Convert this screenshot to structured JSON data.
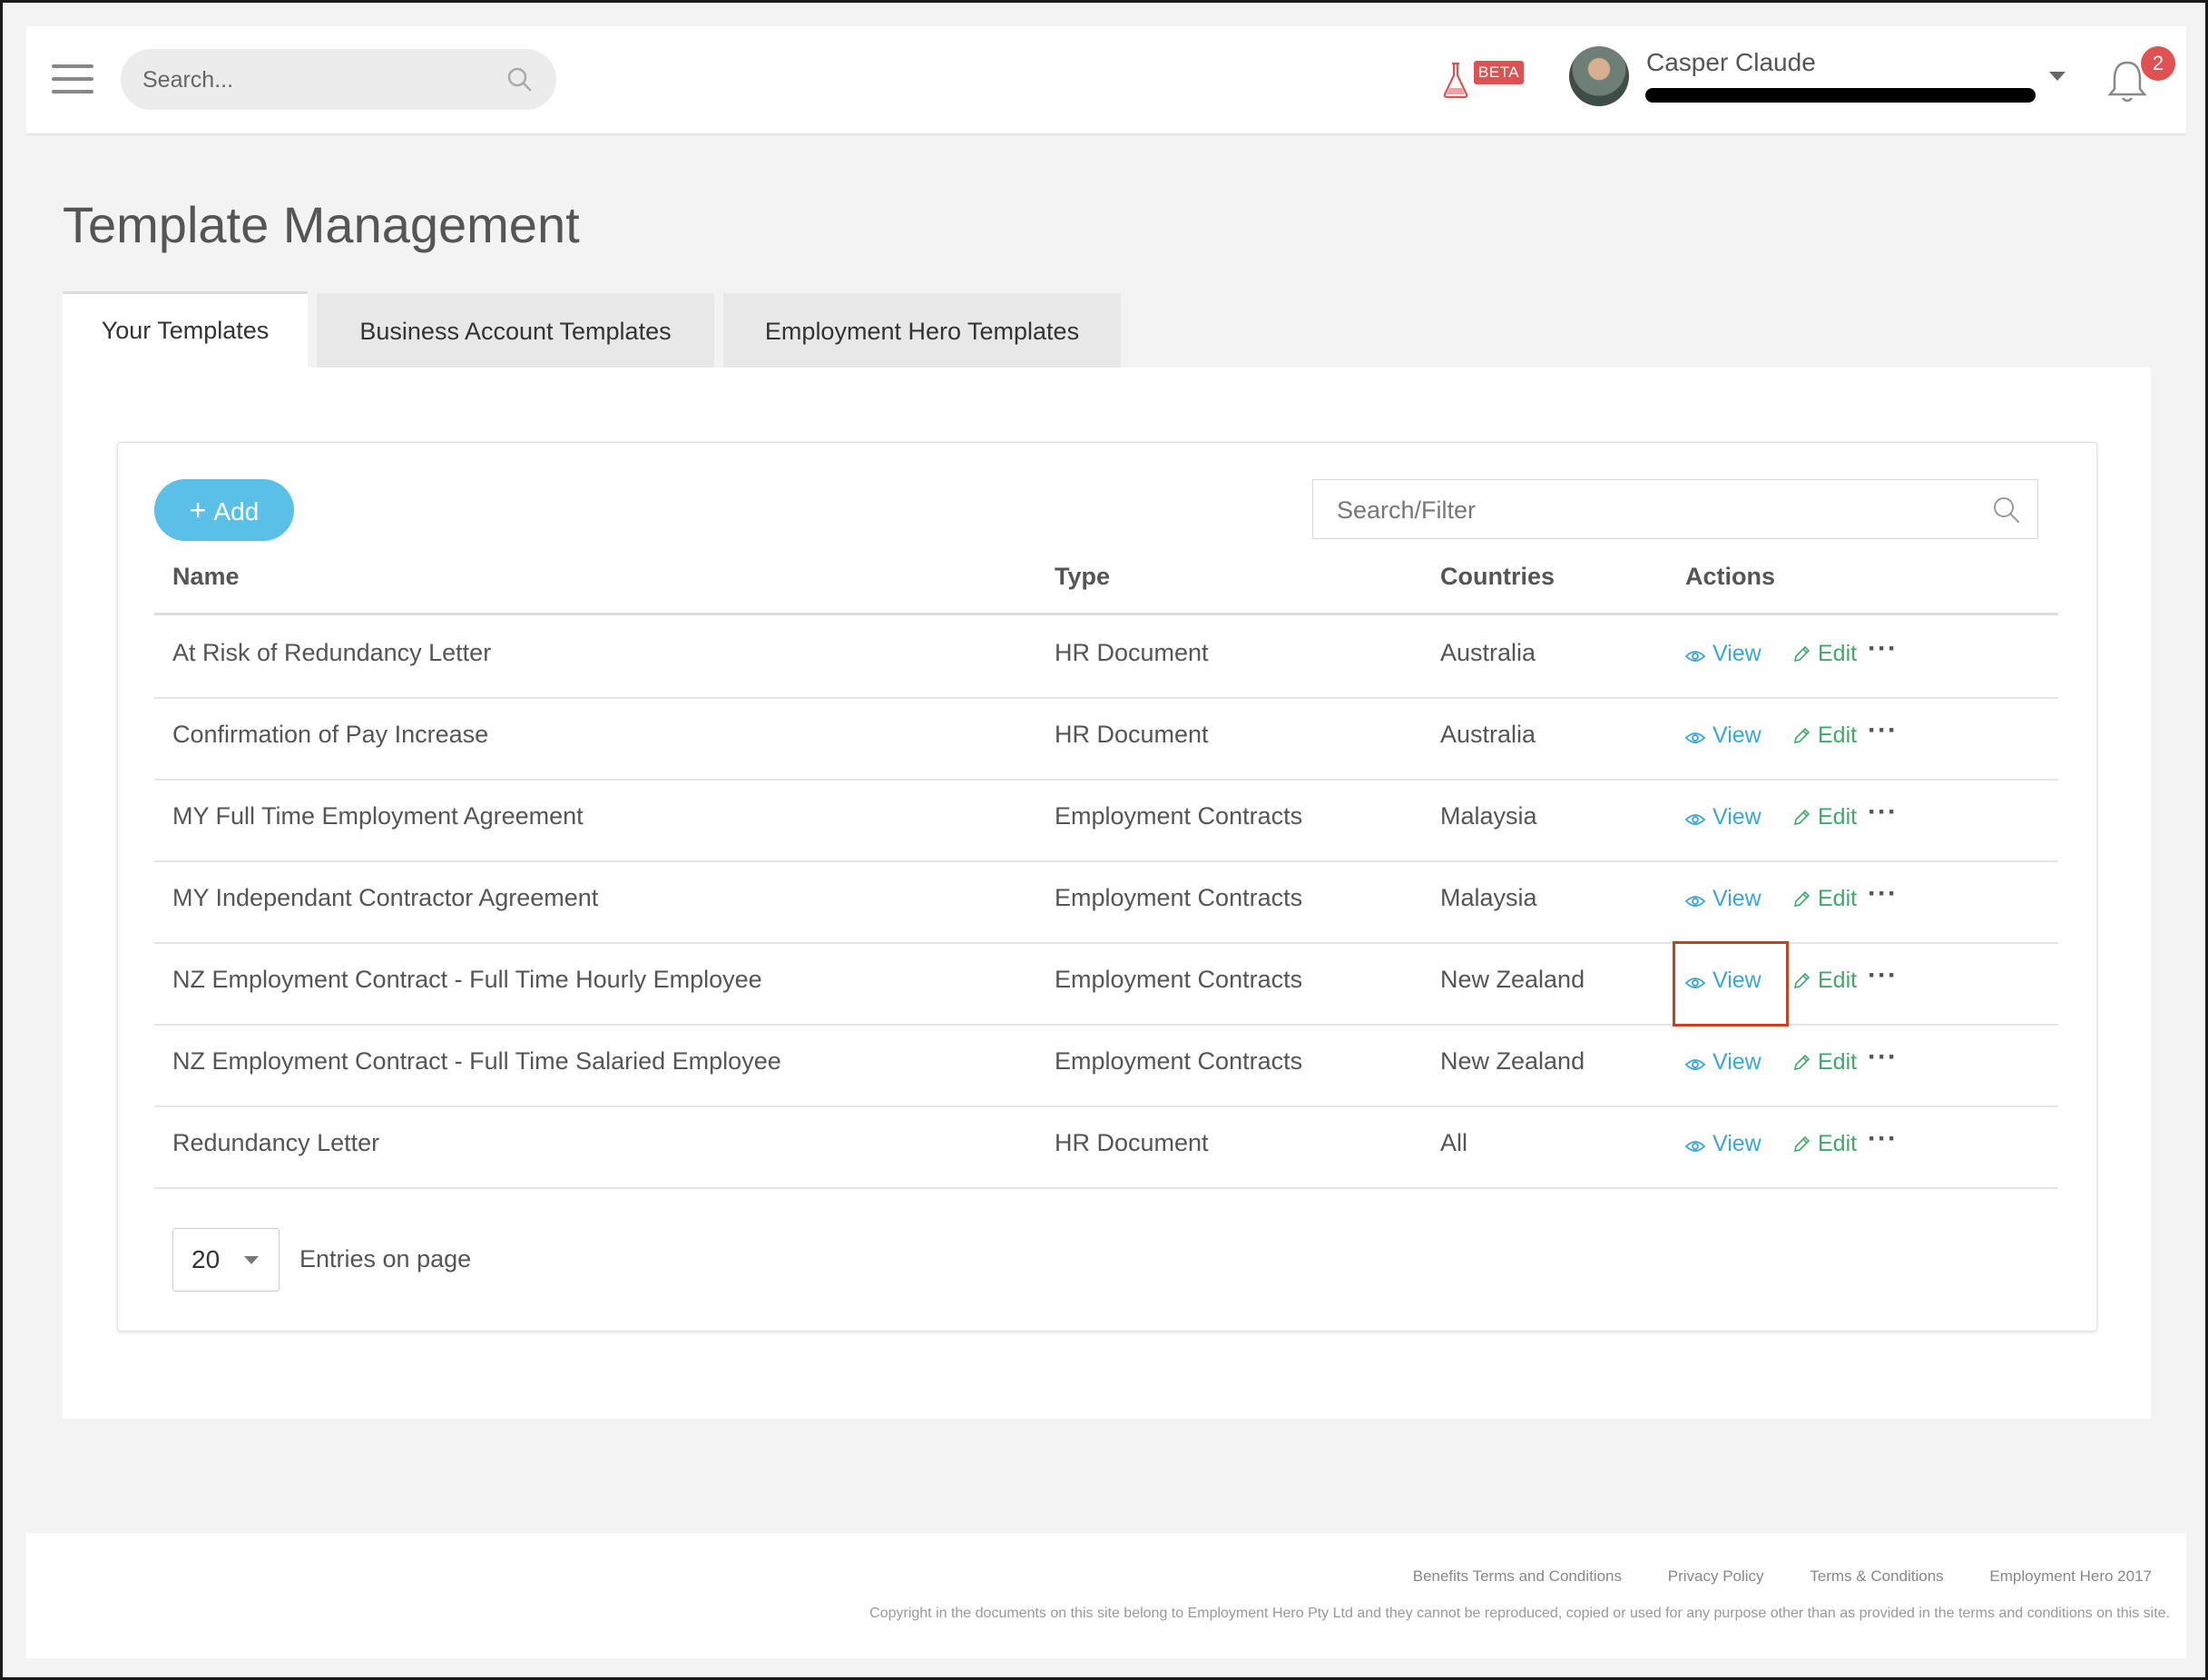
{
  "header": {
    "search_placeholder": "Search...",
    "beta_label": "BETA",
    "user_name": "Casper Claude",
    "notification_count": "2"
  },
  "page": {
    "title": "Template Management"
  },
  "tabs": [
    {
      "label": "Your Templates",
      "active": true
    },
    {
      "label": "Business Account Templates",
      "active": false
    },
    {
      "label": "Employment Hero Templates",
      "active": false
    }
  ],
  "toolbar": {
    "add_label": "Add",
    "filter_placeholder": "Search/Filter"
  },
  "table": {
    "columns": [
      "Name",
      "Type",
      "Countries",
      "Actions"
    ],
    "view_label": "View",
    "edit_label": "Edit",
    "more_label": "···",
    "rows": [
      {
        "name": "At Risk of Redundancy Letter",
        "type": "HR Document",
        "country": "Australia"
      },
      {
        "name": "Confirmation of Pay Increase",
        "type": "HR Document",
        "country": "Australia"
      },
      {
        "name": "MY Full Time Employment Agreement",
        "type": "Employment Contracts",
        "country": "Malaysia"
      },
      {
        "name": "MY Independant Contractor Agreement",
        "type": "Employment Contracts",
        "country": "Malaysia"
      },
      {
        "name": "NZ Employment Contract - Full Time Hourly Employee",
        "type": "Employment Contracts",
        "country": "New Zealand"
      },
      {
        "name": "NZ Employment Contract - Full Time Salaried Employee",
        "type": "Employment Contracts",
        "country": "New Zealand"
      },
      {
        "name": "Redundancy Letter",
        "type": "HR Document",
        "country": "All"
      }
    ]
  },
  "pagination": {
    "per_page": "20",
    "label": "Entries on page"
  },
  "footer": {
    "links": [
      "Benefits Terms and Conditions",
      "Privacy Policy",
      "Terms & Conditions"
    ],
    "company": "Employment Hero 2017",
    "copyright": "Copyright in the documents on this site belong to Employment Hero Pty Ltd and they cannot be reproduced, copied or used for any purpose other than as provided in the terms and conditions on this site."
  },
  "colors": {
    "accent": "#5bc0e8",
    "view": "#3aa6d9",
    "edit": "#3ea96b",
    "badge": "#e05252",
    "highlight": "#c8401e"
  }
}
